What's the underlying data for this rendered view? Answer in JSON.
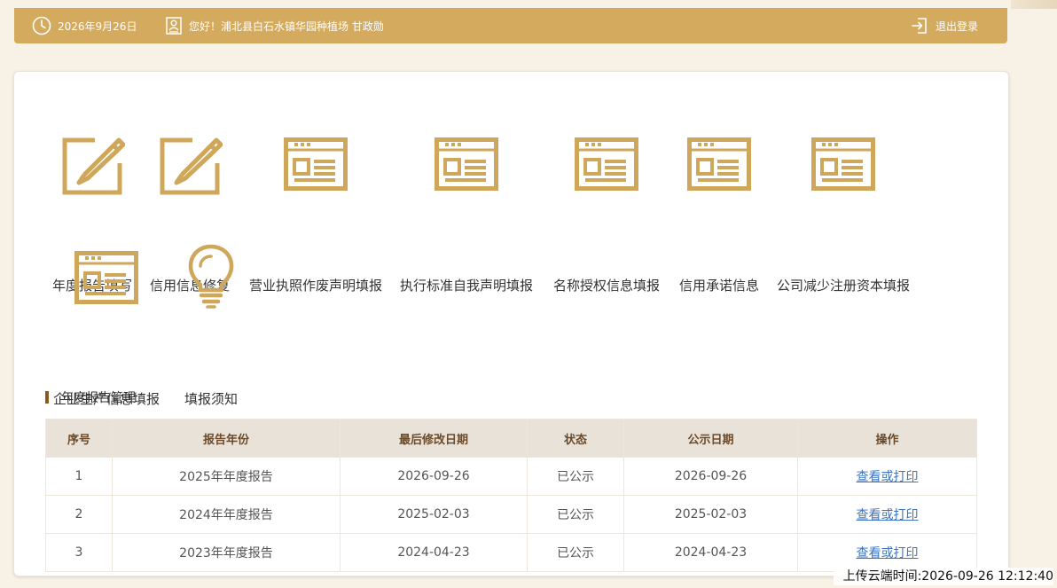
{
  "topbar": {
    "date": "2026年9月26日",
    "greeting": "您好！浦北县白石水镇华园种植场 甘政勋",
    "logout_label": "退出登录"
  },
  "colors": {
    "gold": "#d4aa5e",
    "icon_gold": "#cfa75b",
    "link_blue": "#3c74c0"
  },
  "tiles": [
    {
      "label": "年度报告填写",
      "icon": "edit-icon"
    },
    {
      "label": "信用信息修复",
      "icon": "edit-icon"
    },
    {
      "label": "营业执照作废声明填报",
      "icon": "form-window-icon"
    },
    {
      "label": "执行标准自我声明填报",
      "icon": "form-window-icon"
    },
    {
      "label": "名称授权信息填报",
      "icon": "form-window-icon"
    },
    {
      "label": "信用承诺信息",
      "icon": "form-window-icon"
    },
    {
      "label": "公司减少注册资本填报",
      "icon": "form-window-icon"
    },
    {
      "label": "企业生产信息填报",
      "icon": "form-window-icon"
    },
    {
      "label": "填报须知",
      "icon": "lightbulb-icon"
    }
  ],
  "section": {
    "title": "年度报告管理"
  },
  "table": {
    "headers": [
      "序号",
      "报告年份",
      "最后修改日期",
      "状态",
      "公示日期",
      "操作"
    ],
    "rows": [
      {
        "no": "1",
        "year": "2025年年度报告",
        "modified": "2026-09-26",
        "status": "已公示",
        "published": "2026-09-26",
        "action": "查看或打印"
      },
      {
        "no": "2",
        "year": "2024年年度报告",
        "modified": "2025-02-03",
        "status": "已公示",
        "published": "2025-02-03",
        "action": "查看或打印"
      },
      {
        "no": "3",
        "year": "2023年年度报告",
        "modified": "2024-04-23",
        "status": "已公示",
        "published": "2024-04-23",
        "action": "查看或打印"
      }
    ]
  },
  "footer": {
    "upload_time": "上传云端时间:2026-09-26 12:12:40"
  }
}
